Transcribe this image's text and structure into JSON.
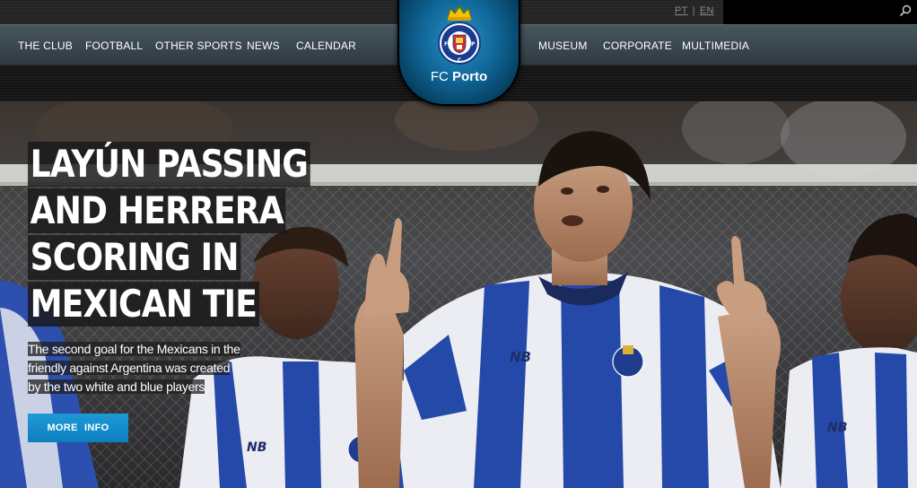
{
  "languages": [
    "PT",
    "EN"
  ],
  "nav_left": [
    "THE CLUB",
    "FOOTBALL",
    "OTHER SPORTS",
    "NEWS",
    "CALENDAR"
  ],
  "nav_right": [
    "MUSEUM",
    "CORPORATE",
    "MULTIMEDIA"
  ],
  "logo": {
    "fc": "FC",
    "name": "Porto",
    "crest_letters": "FCP"
  },
  "hero": {
    "headline_lines": [
      "LAYÚN PASSING",
      "AND HERRERA",
      "SCORING IN",
      "MEXICAN TIE"
    ],
    "summary": "The second goal for the Mexicans in the friendly against Argentina was created by the two white and blue players",
    "button": "MORE  INFO"
  },
  "colors": {
    "nav_bg": "#3e4c53",
    "logo_blue": "#0f6596",
    "button_blue": "#1d9ad6",
    "kit_blue": "#1d3f9e"
  }
}
